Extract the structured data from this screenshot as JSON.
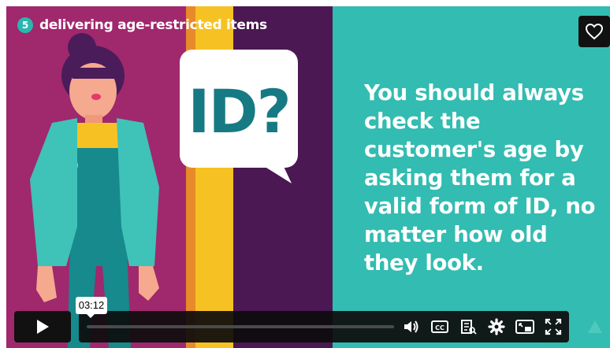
{
  "video": {
    "episode_number": "5",
    "episode_title": "delivering age-restricted items",
    "bubble_text": "ID?",
    "message": "You should always check the customer's age by asking them for a valid form of ID, no matter how old they look."
  },
  "player": {
    "hover_time": "03:12",
    "progress_fraction": 0.0,
    "icons": [
      "play-icon",
      "heart-icon",
      "volume-icon",
      "captions-icon",
      "transcript-icon",
      "settings-icon",
      "picture-in-picture-icon",
      "fullscreen-icon"
    ]
  },
  "colors": {
    "magenta": "#a0286d",
    "purple": "#4b1853",
    "yellow": "#f6c223",
    "teal": "#33bcb1",
    "bubble_text": "#167a84"
  }
}
